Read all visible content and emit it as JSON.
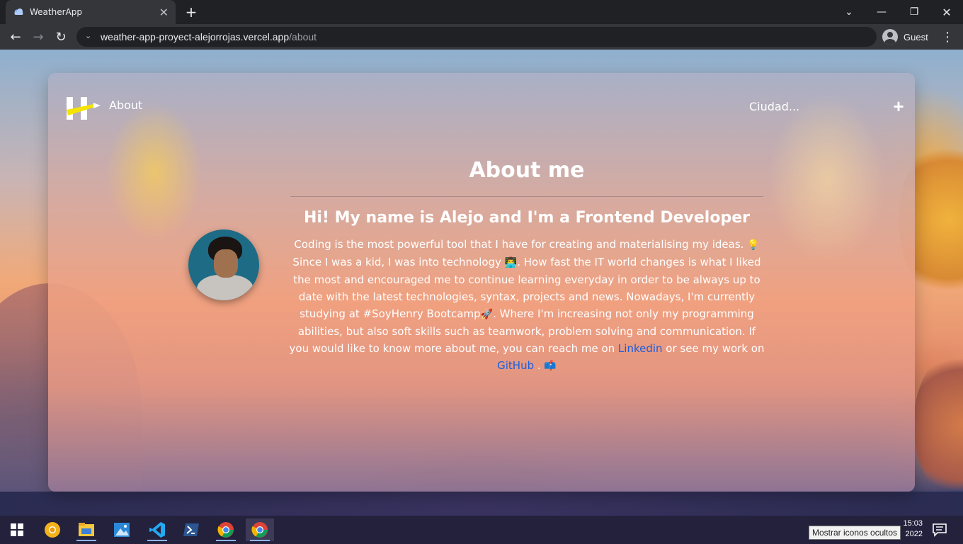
{
  "browser": {
    "tab_title": "WeatherApp",
    "new_tab_glyph": "+",
    "url_host": "weather-app-proyect-alejorrojas.vercel.app",
    "url_path": "/about",
    "profile_name": "Guest"
  },
  "app": {
    "nav_label": "About",
    "city_placeholder": "Ciudad...",
    "add_label": "+"
  },
  "about": {
    "heading": "About me",
    "subheading": "Hi! My name is Alejo and I'm a Frontend Developer",
    "bio_part1": "Coding is the most powerful tool that I have for creating and materialising my ideas. ",
    "bio_emoji1": "💡",
    "bio_part2": " Since I was a kid, I was into technology ",
    "bio_emoji2": "👨‍💻",
    "bio_part3": ". How fast the IT world changes is what I liked the most and encouraged me to continue learning everyday in order to be always up to date with the latest technologies, syntax, projects and news. Nowadays, I'm currently studying at #SoyHenry Bootcamp",
    "bio_emoji3": "🚀",
    "bio_part4": ". Where I'm increasing not only my programming abilities, but also soft skills such as teamwork, problem solving and communication. If you would like to know more about me, you can reach me on ",
    "linkedin_label": "Linkedin",
    "bio_part5": " or see my work on ",
    "github_label": "GitHub",
    "bio_part6": " . ",
    "bio_emoji4": "📫"
  },
  "taskbar": {
    "time": "15:03",
    "date_partial": "2022",
    "tooltip": "Mostrar iconos ocultos",
    "icons": [
      "windows-start-icon",
      "chrome-canary-icon",
      "file-explorer-icon",
      "photos-icon",
      "vscode-icon",
      "powershell-icon",
      "chrome-icon",
      "chrome-active-icon"
    ]
  },
  "colors": {
    "link": "#1a5fe0",
    "text": "#ffffff",
    "logo_yellow": "#f5e300"
  }
}
